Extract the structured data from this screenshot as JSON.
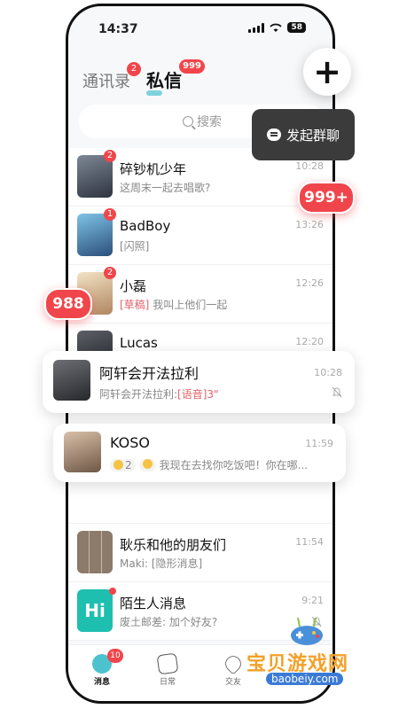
{
  "status": {
    "time": "14:37",
    "battery": "58"
  },
  "tabs": [
    {
      "label": "通讯录",
      "badge": "2"
    },
    {
      "label": "私信",
      "badge": "999"
    }
  ],
  "search": {
    "placeholder": "搜索"
  },
  "actions": {
    "plus": "+",
    "start_group": "发起群聊"
  },
  "floating_badges": {
    "top": "999+",
    "left": "988"
  },
  "conversations": [
    {
      "name": "碎钞机少年",
      "preview": "这周末一起去唱歌?",
      "time": "10:28",
      "badge": "2"
    },
    {
      "name": "BadBoy",
      "preview": "[闪照]",
      "time": "13:26",
      "badge": "1"
    },
    {
      "name": "小磊",
      "tag": "[草稿]",
      "preview": "我叫上他们一起",
      "time": "12:26",
      "badge": "2"
    },
    {
      "name": "Lucas",
      "preview": "",
      "time": "12:20"
    }
  ],
  "card_ax": {
    "name": "阿轩会开法拉利",
    "prefix": "阿轩会开法拉利:",
    "tag": "[语音]3\"",
    "time": "10:28"
  },
  "card_koso": {
    "name": "KOSO",
    "reaction_count": "2",
    "preview": "我现在去找你吃饭吧！你在哪...",
    "time": "11:59"
  },
  "conversations_bottom": [
    {
      "name": "耿乐和他的朋友们",
      "preview": "Maki: [隐形消息]",
      "time": "11:54"
    },
    {
      "name": "陌生人消息",
      "preview": "废土邮差: 加个好友?",
      "time": "9:21",
      "avatar_text": "Hi"
    }
  ],
  "bottom_nav": [
    {
      "label": "消息",
      "badge": "10"
    },
    {
      "label": "日常"
    },
    {
      "label": "交友"
    }
  ],
  "watermark": {
    "text": "宝贝游戏网",
    "url": "baobeiy.com"
  },
  "colors": {
    "accent_red": "#f0464b",
    "teal": "#4cc2ce",
    "dark_btn": "#3b3b3b"
  }
}
